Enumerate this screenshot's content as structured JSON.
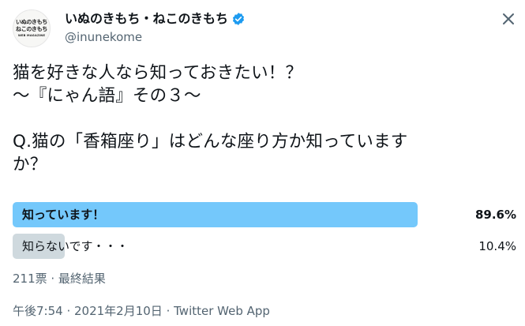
{
  "header": {
    "avatar_line1": "いぬのきもち",
    "avatar_line2": "ねこのきもち",
    "avatar_line3": "WEB MAGAZINE",
    "display_name": "いぬのきもち・ねこのきもち",
    "handle": "@inunekome"
  },
  "tweet": {
    "line1": "猫を好きな人なら知っておきたい！？",
    "line2": "〜『にゃん語』その３〜",
    "line3": "Q.猫の「香箱座り」はどんな座り方か知っていますか？"
  },
  "poll": {
    "options": [
      {
        "label": "知っています！",
        "percent_text": "89.6%",
        "percent": 89.6,
        "winner": true
      },
      {
        "label": "知らないです・・・",
        "percent_text": "10.4%",
        "percent": 10.4,
        "winner": false
      }
    ],
    "meta": "211票 · 最終結果"
  },
  "footer": {
    "time": "午後7:54",
    "sep1": " · ",
    "date": "2021年2月10日",
    "sep2": " · ",
    "source": "Twitter Web App"
  },
  "colors": {
    "winner_bar": "#74c8fb",
    "loser_bar": "#cfd9de",
    "verified": "#1d9bf0",
    "muted_text": "#536471"
  },
  "icons": {
    "verified": "verified-badge-icon",
    "close": "close-icon"
  }
}
